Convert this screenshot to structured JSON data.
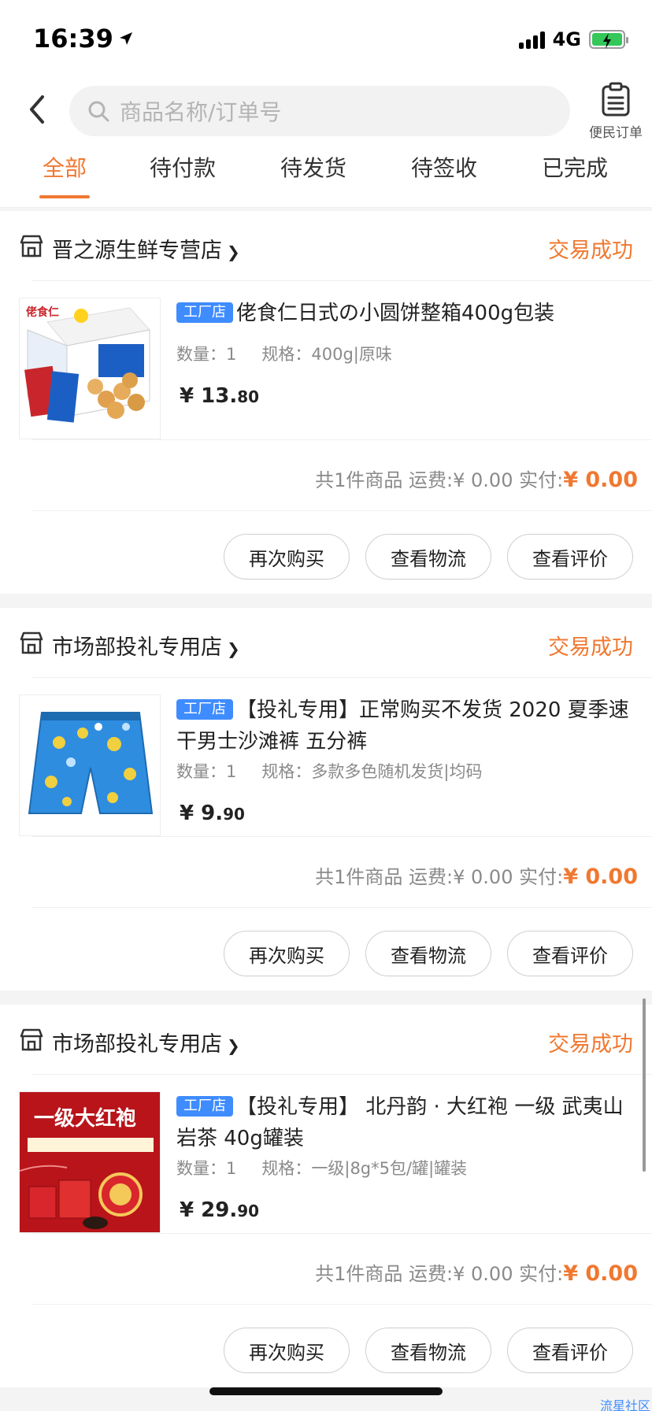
{
  "status_bar": {
    "time": "16:39",
    "network": "4G"
  },
  "search": {
    "placeholder": "商品名称/订单号"
  },
  "order_shortcut": {
    "label": "便民订单"
  },
  "tabs": [
    {
      "label": "全部",
      "active": true
    },
    {
      "label": "待付款"
    },
    {
      "label": "待发货"
    },
    {
      "label": "待签收"
    },
    {
      "label": "已完成"
    }
  ],
  "orders": [
    {
      "store": "晋之源生鲜专营店",
      "status": "交易成功",
      "tag": "工厂店",
      "title": "佬食仁日式の小圆饼整箱400g包装",
      "qty_label": "数量：",
      "qty": "1",
      "spec_label": "规格：",
      "spec": "400g|原味",
      "price_int": "¥ 13.",
      "price_dec": "80",
      "summary": "共1件商品 运费:¥ 0.00  实付:",
      "paid": "¥ 0.00"
    },
    {
      "store": "市场部投礼专用店",
      "status": "交易成功",
      "tag": "工厂店",
      "title": "【投礼专用】正常购买不发货 2020 夏季速干男士沙滩裤 五分裤",
      "qty_label": "数量：",
      "qty": "1",
      "spec_label": "规格：",
      "spec": "多款多色随机发货|均码",
      "price_int": "¥ 9.",
      "price_dec": "90",
      "summary": "共1件商品 运费:¥ 0.00  实付:",
      "paid": "¥ 0.00"
    },
    {
      "store": "市场部投礼专用店",
      "status": "交易成功",
      "tag": "工厂店",
      "title": "【投礼专用】 北丹韵 · 大红袍 一级 武夷山 岩茶 40g罐装",
      "qty_label": "数量：",
      "qty": "1",
      "spec_label": "规格：",
      "spec": "一级|8g*5包/罐|罐装",
      "price_int": "¥ 29.",
      "price_dec": "90",
      "summary": "共1件商品 运费:¥ 0.00  实付:",
      "paid": "¥ 0.00"
    }
  ],
  "actions": {
    "rebuy": "再次购买",
    "logistics": "查看物流",
    "review": "查看评价"
  },
  "thumb_text": {
    "biscuit_brand": "佬食仁",
    "tea_banner": "一级大红袍"
  },
  "watermark": "流星社区",
  "colors": {
    "accent": "#f07830",
    "tag": "#3f8cff",
    "battery": "#34c759"
  }
}
